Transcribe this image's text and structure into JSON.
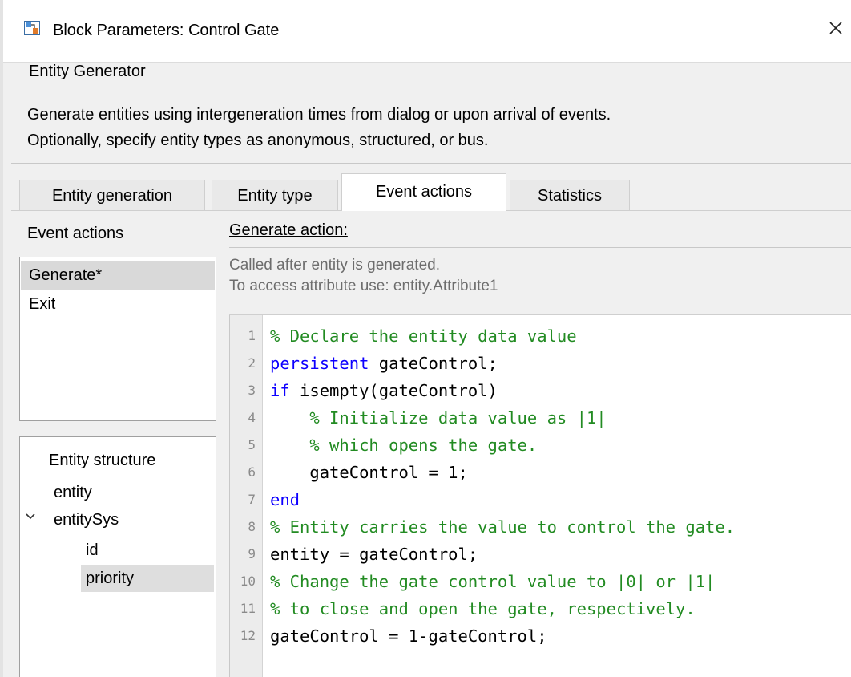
{
  "window": {
    "title": "Block Parameters: Control Gate",
    "close_icon": "close-icon",
    "app_icon": "simulink-block-icon"
  },
  "block": {
    "group_title": "Entity Generator",
    "description_lines": [
      "Generate entities using intergeneration times from dialog or upon arrival of events.",
      "Optionally, specify entity types as anonymous, structured, or bus."
    ]
  },
  "tabs": [
    {
      "label": "Entity generation"
    },
    {
      "label": "Entity type"
    },
    {
      "label": "Event actions",
      "active": true
    },
    {
      "label": "Statistics"
    }
  ],
  "event_actions": {
    "label": "Event actions",
    "items": [
      {
        "label": "Generate*",
        "selected": true
      },
      {
        "label": "Exit",
        "selected": false
      }
    ]
  },
  "entity_structure": {
    "title": "Entity structure",
    "items": [
      {
        "label": "entity"
      },
      {
        "label": "entitySys",
        "expanded": true
      },
      {
        "label": "id"
      },
      {
        "label": "priority",
        "selected": true
      }
    ]
  },
  "generate_action": {
    "heading": "Generate action:",
    "hint_lines": [
      "Called after entity is generated.",
      "To access attribute use: entity.Attribute1"
    ]
  },
  "code": {
    "colors": {
      "comment": "#228b22",
      "keyword": "#0e00ff",
      "text": "#000000"
    },
    "lines": [
      {
        "n": "1",
        "parts": [
          {
            "t": "% Declare the entity data value",
            "c": "cm"
          }
        ]
      },
      {
        "n": "2",
        "parts": [
          {
            "t": "persistent",
            "c": "kw"
          },
          {
            "t": " gateControl;",
            "c": "tx"
          }
        ]
      },
      {
        "n": "3",
        "parts": [
          {
            "t": "if",
            "c": "kw"
          },
          {
            "t": " isempty(gateControl)",
            "c": "tx"
          }
        ]
      },
      {
        "n": "4",
        "parts": [
          {
            "t": "    % Initialize data value as |1|",
            "c": "cm"
          }
        ]
      },
      {
        "n": "5",
        "parts": [
          {
            "t": "    % which opens the gate.",
            "c": "cm"
          }
        ]
      },
      {
        "n": "6",
        "parts": [
          {
            "t": "    gateControl = 1;",
            "c": "tx"
          }
        ]
      },
      {
        "n": "7",
        "parts": [
          {
            "t": "end",
            "c": "kw"
          }
        ]
      },
      {
        "n": "8",
        "parts": [
          {
            "t": "% Entity carries the value to control the gate.",
            "c": "cm"
          }
        ]
      },
      {
        "n": "9",
        "parts": [
          {
            "t": "entity = gateControl;",
            "c": "tx"
          }
        ]
      },
      {
        "n": "10",
        "parts": [
          {
            "t": "% Change the gate control value to |0| or |1|",
            "c": "cm"
          }
        ]
      },
      {
        "n": "11",
        "parts": [
          {
            "t": "% to close and open the gate, respectively.",
            "c": "cm"
          }
        ]
      },
      {
        "n": "12",
        "parts": [
          {
            "t": "gateControl = 1-gateControl;",
            "c": "tx"
          }
        ]
      }
    ]
  }
}
